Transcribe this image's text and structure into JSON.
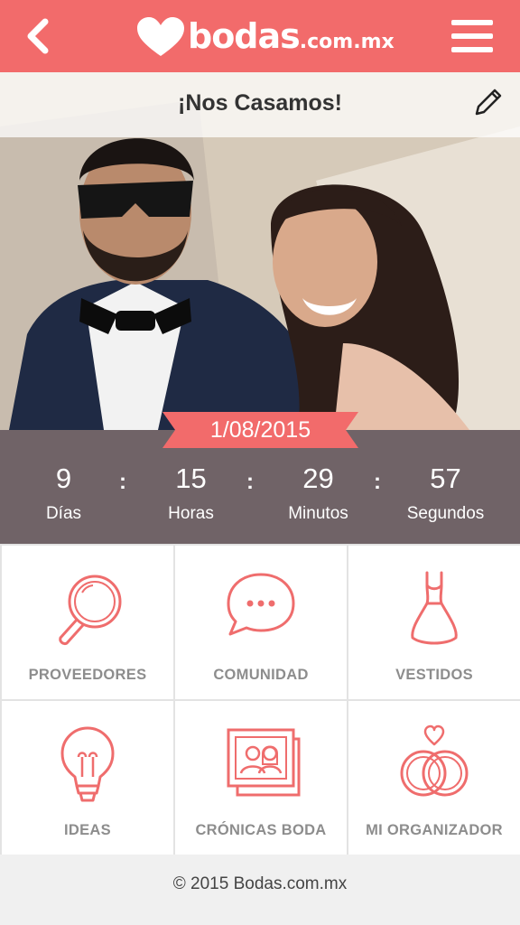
{
  "header": {
    "back_icon": "chevron-left-icon",
    "logo_main": "bodas",
    "logo_suffix": ".com.mx",
    "menu_icon": "hamburger-icon"
  },
  "hero": {
    "title": "¡Nos Casamos!",
    "edit_icon": "pencil-icon",
    "date": "1/08/2015"
  },
  "countdown": [
    {
      "value": "9",
      "label": "Días"
    },
    {
      "value": "15",
      "label": "Horas"
    },
    {
      "value": "29",
      "label": "Minutos"
    },
    {
      "value": "57",
      "label": "Segundos"
    }
  ],
  "countdown_separator": ":",
  "menu_tiles": [
    {
      "label": "PROVEEDORES",
      "icon": "magnifier-icon"
    },
    {
      "label": "COMUNIDAD",
      "icon": "chat-bubble-icon"
    },
    {
      "label": "VESTIDOS",
      "icon": "dress-icon"
    },
    {
      "label": "IDEAS",
      "icon": "lightbulb-icon"
    },
    {
      "label": "CRÓNICAS BODA",
      "icon": "photo-album-icon"
    },
    {
      "label": "MI ORGANIZADOR",
      "icon": "rings-icon"
    }
  ],
  "footer": {
    "copyright": "© 2015 Bodas.com.mx"
  },
  "colors": {
    "accent": "#f26b6b",
    "countdown_bg": "#706367",
    "icon_stroke": "#ef6d6d",
    "tile_label": "#8d8d8d"
  }
}
